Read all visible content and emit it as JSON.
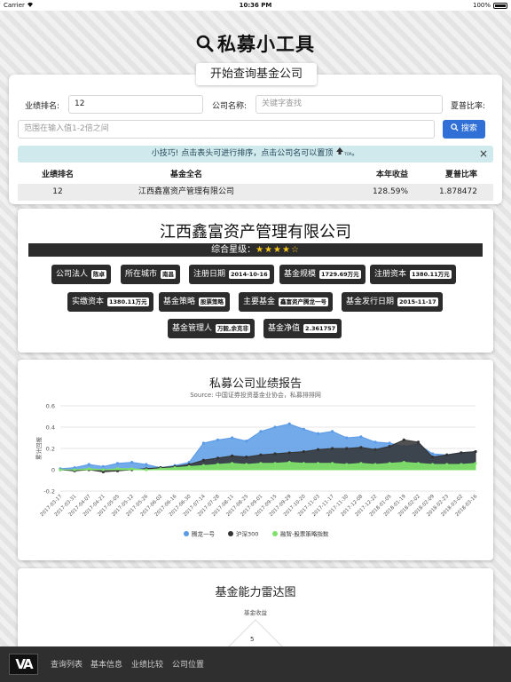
{
  "status": {
    "carrier": "Carrier",
    "time": "10:36 PM",
    "battery": "100%"
  },
  "page_title": "私募小工具",
  "section_tag": "开始查询基金公司",
  "query": {
    "rank_label": "业绩排名:",
    "rank_value": "12",
    "company_label": "公司名称:",
    "company_placeholder": "关键字查找",
    "sharpe_label": "夏普比率:",
    "range_placeholder": "范围在输入值1-2倍之间",
    "search_label": "搜索",
    "tip": "小技巧! 点击表头可进行排序，点击公司名可以置顶",
    "tip_suffix": "。",
    "tip_icon_label": "TOP",
    "close": "×"
  },
  "table": {
    "headers": [
      "业绩排名",
      "基金全名",
      "本年收益",
      "夏普比率"
    ],
    "rows": [
      [
        "12",
        "江西鑫富资产管理有限公司",
        "128.59%",
        "1.878472"
      ]
    ]
  },
  "company": {
    "name": "江西鑫富资产管理有限公司",
    "rating_label": "综合星级：",
    "rating_stars": "★★★★☆",
    "rating_value": 4,
    "facts": [
      {
        "label": "公司法人",
        "value": "陈卓"
      },
      {
        "label": "所在城市",
        "value": "南昌"
      },
      {
        "label": "注册日期",
        "value": "2014-10-16"
      },
      {
        "label": "基金规模",
        "value": "1729.69万元"
      },
      {
        "label": "注册资本",
        "value": "1380.11万元"
      },
      {
        "label": "实缴资本",
        "value": "1380.11万元"
      },
      {
        "label": "基金策略",
        "value": "股票策略"
      },
      {
        "label": "主要基金",
        "value": "鑫富资产腾龙一号"
      },
      {
        "label": "基金发行日期",
        "value": "2015-11-17"
      },
      {
        "label": "基金管理人",
        "value": "万毅,余克非"
      },
      {
        "label": "基金净值",
        "value": "2.361757"
      }
    ]
  },
  "chart_data": {
    "type": "area",
    "title": "私募公司业绩报告",
    "subtitle": "Source: 中国证券投资基金业协会，私募排排网",
    "ylabel": "累计回报",
    "ylim": [
      -0.2,
      0.6
    ],
    "yticks": [
      "0.6",
      "0.4",
      "0.2",
      "0",
      "-0.2"
    ],
    "x": [
      "2017-03-17",
      "2017-03-31",
      "2017-04-07",
      "2017-04-21",
      "2017-05-05",
      "2017-05-12",
      "2017-05-26",
      "2017-06-02",
      "2017-06-16",
      "2017-06-30",
      "2017-07-14",
      "2017-07-28",
      "2017-08-11",
      "2017-08-25",
      "2017-09-01",
      "2017-09-15",
      "2017-09-29",
      "2017-10-20",
      "2017-11-03",
      "2017-11-17",
      "2017-11-30",
      "2017-12-08",
      "2017-12-22",
      "2018-01-05",
      "2018-01-19",
      "2018-02-02",
      "2018-02-09",
      "2018-02-23",
      "2018-03-02",
      "2018-03-16"
    ],
    "legend_position": "bottom",
    "series": [
      {
        "name": "腾龙一号",
        "color": "#5b9be6",
        "values": [
          0.01,
          0.02,
          0.05,
          0.03,
          0.06,
          0.07,
          0.05,
          0.02,
          0.04,
          0.07,
          0.25,
          0.28,
          0.3,
          0.27,
          0.36,
          0.4,
          0.43,
          0.38,
          0.34,
          0.36,
          0.3,
          0.31,
          0.26,
          0.25,
          0.22,
          0.24,
          0.15,
          0.14,
          0.16,
          0.17
        ]
      },
      {
        "name": "沪深300",
        "color": "#333333",
        "values": [
          0.0,
          -0.01,
          0.0,
          -0.02,
          -0.01,
          0.0,
          0.01,
          0.02,
          0.03,
          0.05,
          0.09,
          0.11,
          0.13,
          0.12,
          0.14,
          0.15,
          0.16,
          0.17,
          0.19,
          0.2,
          0.2,
          0.21,
          0.19,
          0.22,
          0.28,
          0.26,
          0.12,
          0.14,
          0.16,
          0.17
        ]
      },
      {
        "name": "融智-股票策略指数",
        "color": "#7ee06a",
        "values": [
          0.0,
          0.0,
          0.01,
          0.0,
          0.01,
          0.01,
          0.0,
          0.01,
          0.02,
          0.03,
          0.04,
          0.05,
          0.06,
          0.05,
          0.06,
          0.06,
          0.07,
          0.06,
          0.06,
          0.06,
          0.05,
          0.06,
          0.05,
          0.06,
          0.07,
          0.06,
          0.05,
          0.05,
          0.05,
          0.06
        ]
      }
    ]
  },
  "radar": {
    "title": "基金能力雷达图",
    "axis_label": "基金收益",
    "tick": "5"
  },
  "nav": {
    "logo": "VA",
    "items": [
      "查询列表",
      "基本信息",
      "业绩比较",
      "公司位置"
    ]
  }
}
